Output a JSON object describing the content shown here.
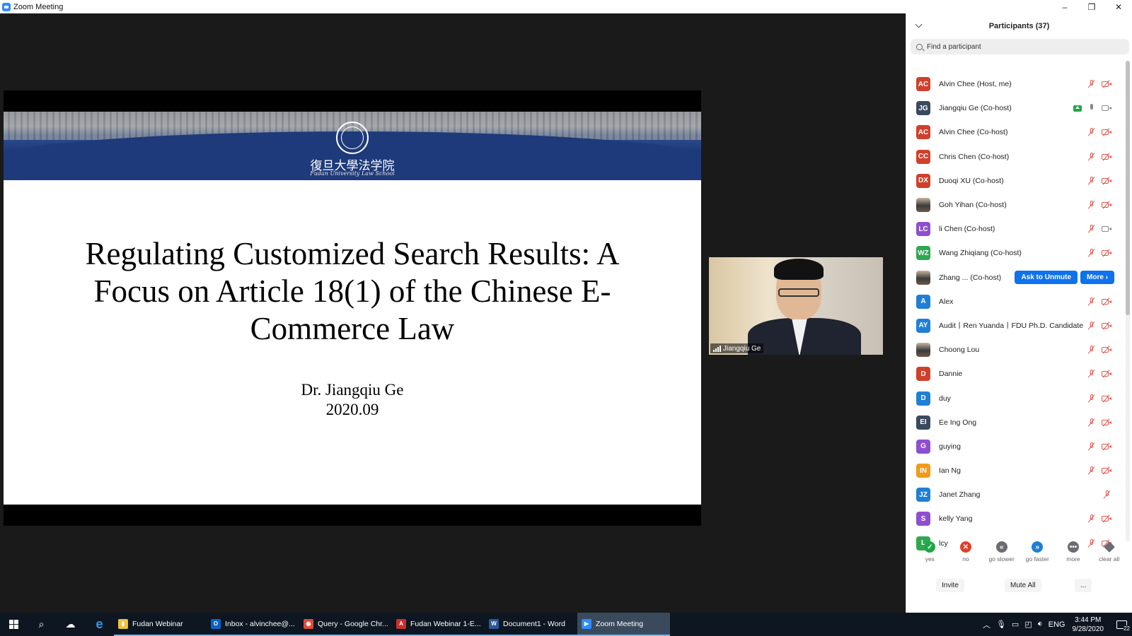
{
  "window": {
    "title": "Zoom Meeting",
    "controls": [
      "–",
      "❐",
      "✕"
    ]
  },
  "slide": {
    "school_cn": "復旦大學法学院",
    "school_en": "Fudan University Law School",
    "title": "Regulating Customized Search Results: A Focus on Article 18(1) of the Chinese E-Commerce Law",
    "author": "Dr. Jiangqiu Ge",
    "date": "2020.09"
  },
  "speaker": {
    "name": "Jiangqiu Ge"
  },
  "panel": {
    "title": "Participants (37)",
    "search_placeholder": "Find a participant",
    "participants": [
      {
        "initials": "AC",
        "name": "Alvin Chee (Host, me)",
        "color": "#d0402b",
        "mic": "muted",
        "video": "off"
      },
      {
        "initials": "JG",
        "name": "Jiangqiu Ge (Co-host)",
        "color": "#3a4a5e",
        "mic": "on",
        "video": "on",
        "sharing": true
      },
      {
        "initials": "AC",
        "name": "Alvin Chee (Co-host)",
        "color": "#d0402b",
        "mic": "muted",
        "video": "off"
      },
      {
        "initials": "CC",
        "name": "Chris Chen (Co-host)",
        "color": "#d0402b",
        "mic": "muted",
        "video": "off"
      },
      {
        "initials": "DX",
        "name": "Duoqi XU (Co-host)",
        "color": "#d0402b",
        "mic": "muted",
        "video": "off"
      },
      {
        "initials": "",
        "name": "Goh Yihan (Co-host)",
        "photo": true,
        "mic": "muted",
        "video": "off"
      },
      {
        "initials": "LC",
        "name": "li Chen (Co-host)",
        "color": "#8d4fcf",
        "mic": "muted",
        "video": "on"
      },
      {
        "initials": "WZ",
        "name": "Wang Zhiqiang (Co-host)",
        "color": "#2ea84f",
        "mic": "muted",
        "video": "off"
      },
      {
        "initials": "",
        "name": "Zhang ...     (Co-host)",
        "photo": true,
        "hover": true
      },
      {
        "initials": "A",
        "name": "Alex",
        "color": "#1f7fd6",
        "mic": "muted",
        "video": "off"
      },
      {
        "initials": "AY",
        "name": "Audit丨Ren Yuanda丨FDU Ph.D. Candidate",
        "color": "#1f7fd6",
        "mic": "muted",
        "video": "off"
      },
      {
        "initials": "",
        "name": "Choong Lou",
        "photo": true,
        "mic": "muted",
        "video": "off"
      },
      {
        "initials": "D",
        "name": "Dannie",
        "color": "#d0402b",
        "mic": "muted",
        "video": "off"
      },
      {
        "initials": "D",
        "name": "duy",
        "color": "#1f7fd6",
        "mic": "muted",
        "video": "off"
      },
      {
        "initials": "EI",
        "name": "Ee Ing Ong",
        "color": "#3a4a5e",
        "mic": "muted",
        "video": "off"
      },
      {
        "initials": "G",
        "name": "guying",
        "color": "#8d4fcf",
        "mic": "muted",
        "video": "off"
      },
      {
        "initials": "IN",
        "name": "Ian Ng",
        "color": "#f29a1a",
        "mic": "muted",
        "video": "off"
      },
      {
        "initials": "JZ",
        "name": "Janet Zhang",
        "color": "#1f7fd6",
        "mic": "muted",
        "video": "none"
      },
      {
        "initials": "S",
        "name": "kelly Yang",
        "color": "#8d4fcf",
        "mic": "muted",
        "video": "off"
      },
      {
        "initials": "L",
        "name": "lcy",
        "color": "#2ea84f",
        "mic": "muted",
        "video": "off"
      }
    ],
    "hover_buttons": {
      "ask_unmute": "Ask to Unmute",
      "more": "More ›"
    },
    "reactions": [
      {
        "label": "yes",
        "glyph": "✓",
        "color": "#22a647"
      },
      {
        "label": "no",
        "glyph": "✕",
        "color": "#e0402b"
      },
      {
        "label": "go slower",
        "glyph": "«",
        "color": "#6b6b72"
      },
      {
        "label": "go faster",
        "glyph": "»",
        "color": "#1f7fd6"
      },
      {
        "label": "more",
        "glyph": "•••",
        "color": "#6b6b72"
      },
      {
        "label": "clear all",
        "glyph": "",
        "color": "#6b6b72"
      }
    ],
    "footer": {
      "invite": "Invite",
      "mute_all": "Mute All",
      "more": "..."
    }
  },
  "taskbar": {
    "apps": [
      {
        "label": "Fudan Webinar",
        "badge": "▮",
        "color": "#f3c13a"
      },
      {
        "label": "Inbox - alvinchee@...",
        "badge": "O",
        "color": "#0a64c2"
      },
      {
        "label": "Query - Google Chr...",
        "badge": "◉",
        "color": "#e04b3a"
      },
      {
        "label": "Fudan Webinar 1-E...",
        "badge": "A",
        "color": "#c9302c"
      },
      {
        "label": "Document1 - Word",
        "badge": "W",
        "color": "#2b5797"
      },
      {
        "label": "Zoom Meeting",
        "badge": "▶",
        "color": "#2d8cff",
        "active": true
      }
    ],
    "lang": "ENG",
    "time": "3:44 PM",
    "date": "9/28/2020",
    "notifications": "22"
  }
}
